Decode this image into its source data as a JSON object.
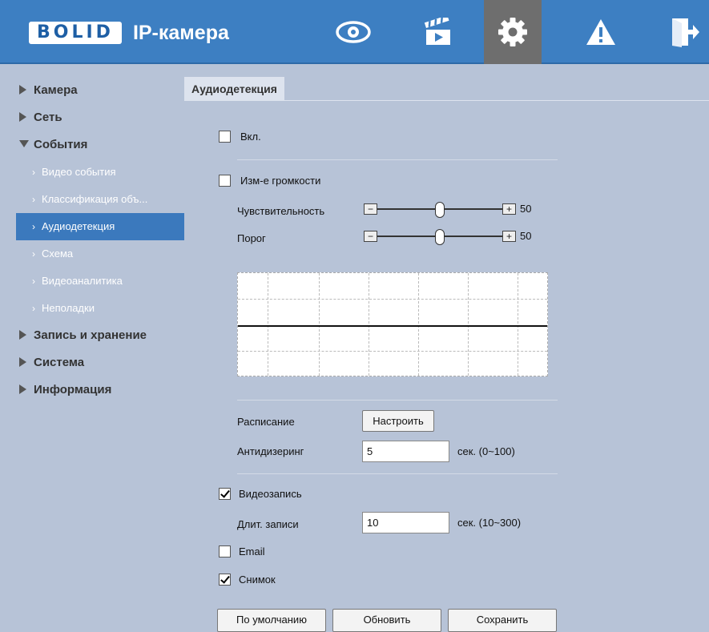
{
  "header": {
    "logo_brand": "BOLID",
    "logo_product": "IP-камера",
    "nav_icons": [
      "eye-icon",
      "clapperboard-icon",
      "gear-icon",
      "warning-icon",
      "exit-icon"
    ],
    "active_nav": "gear-icon",
    "colors": {
      "bar": "#3d7fc2",
      "active": "#6e6e6e"
    }
  },
  "sidebar": {
    "items": [
      {
        "label": "Камера",
        "expanded": false
      },
      {
        "label": "Сеть",
        "expanded": false
      },
      {
        "label": "События",
        "expanded": true,
        "children": [
          "Видео события",
          "Классификация объ...",
          "Аудиодетекция",
          "Схема",
          "Видеоаналитика",
          "Неполадки"
        ],
        "active_child": "Аудиодетекция"
      },
      {
        "label": "Запись и хранение",
        "expanded": false
      },
      {
        "label": "Система",
        "expanded": false
      },
      {
        "label": "Информация",
        "expanded": false
      }
    ]
  },
  "tab": {
    "label": "Аудиодетекция"
  },
  "form": {
    "enable": {
      "label": "Вкл.",
      "checked": false
    },
    "volume_change": {
      "label": "Изм-е громкости",
      "checked": false
    },
    "sensitivity": {
      "label": "Чувствительность",
      "value": "50",
      "fraction": 0.5
    },
    "threshold": {
      "label": "Порог",
      "value": "50",
      "fraction": 0.5
    },
    "schedule": {
      "label": "Расписание",
      "button": "Настроить"
    },
    "antidither": {
      "label": "Антидизеринг",
      "value": "5",
      "unit": "сек. (0~100)"
    },
    "record": {
      "label": "Видеозапись",
      "checked": true
    },
    "record_duration": {
      "label": "Длит. записи",
      "value": "10",
      "unit": "сек. (10~300)"
    },
    "email": {
      "label": "Email",
      "checked": false
    },
    "snapshot": {
      "label": "Снимок",
      "checked": true
    }
  },
  "buttons": {
    "default": "По умолчанию",
    "refresh": "Обновить",
    "save": "Сохранить"
  }
}
